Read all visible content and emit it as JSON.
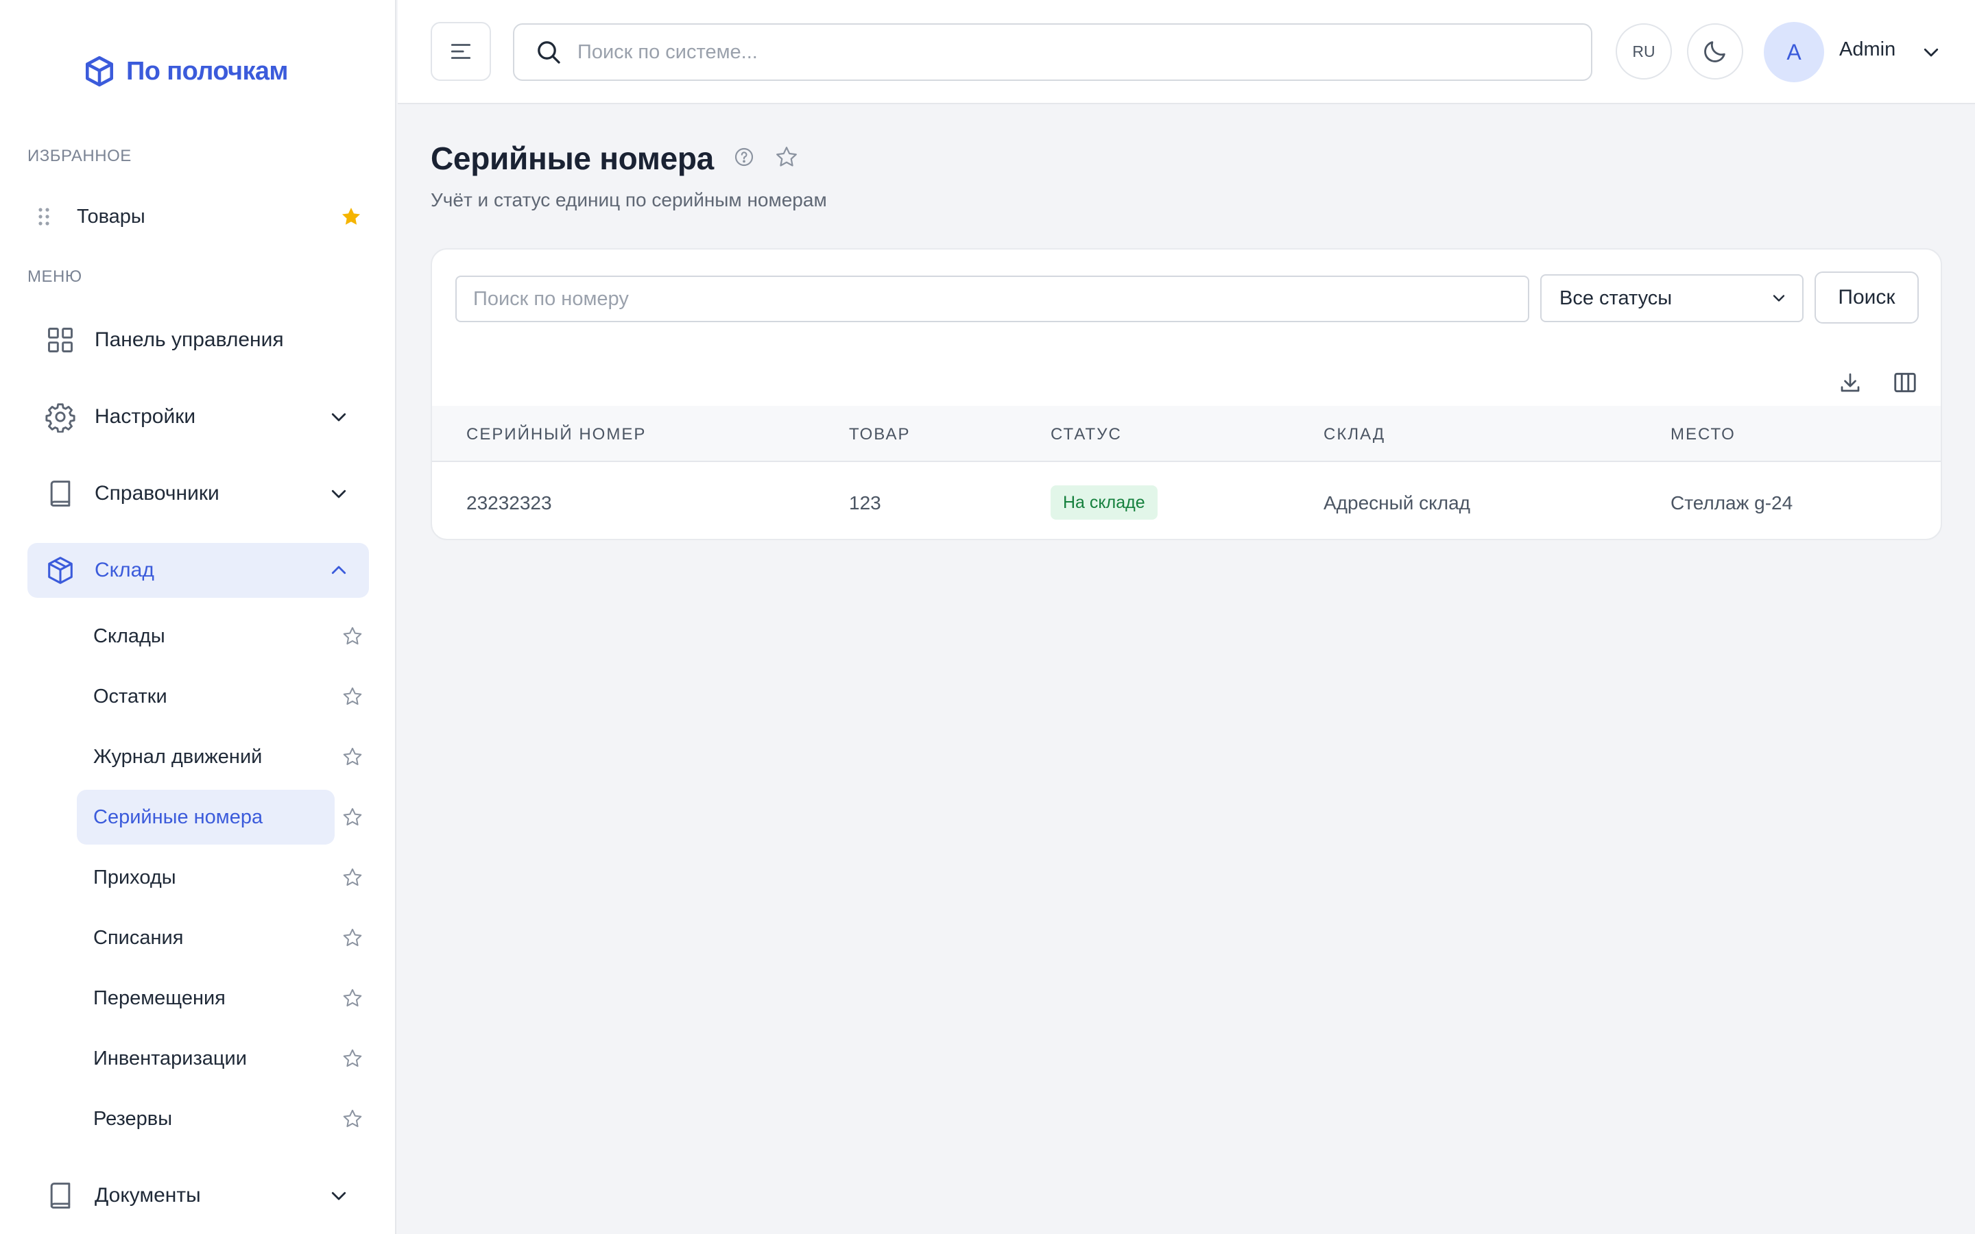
{
  "app": {
    "name": "По полочкам"
  },
  "sidebar": {
    "favorites_label": "ИЗБРАННОЕ",
    "favorites": [
      {
        "label": "Товары"
      }
    ],
    "menu_label": "МЕНЮ",
    "items": [
      {
        "label": "Панель управления",
        "icon": "grid-icon"
      },
      {
        "label": "Настройки",
        "icon": "gear-icon",
        "expanded": false
      },
      {
        "label": "Справочники",
        "icon": "book-icon",
        "expanded": false
      },
      {
        "label": "Склад",
        "icon": "box-icon",
        "expanded": true,
        "active": true
      },
      {
        "label": "Документы",
        "icon": "book-icon",
        "expanded": false
      }
    ],
    "warehouse_subitems": [
      {
        "label": "Склады"
      },
      {
        "label": "Остатки"
      },
      {
        "label": "Журнал движений"
      },
      {
        "label": "Серийные номера",
        "active": true
      },
      {
        "label": "Приходы"
      },
      {
        "label": "Списания"
      },
      {
        "label": "Перемещения"
      },
      {
        "label": "Инвентаризации"
      },
      {
        "label": "Резервы"
      }
    ]
  },
  "topbar": {
    "search_placeholder": "Поиск по системе...",
    "language": "RU",
    "user_initial": "A",
    "user_name": "Admin"
  },
  "page": {
    "title": "Серийные номера",
    "subtitle": "Учёт и статус единиц по серийным номерам"
  },
  "filters": {
    "search_placeholder": "Поиск по номеру",
    "search_value": "",
    "status_selected": "Все статусы",
    "search_button": "Поиск"
  },
  "table": {
    "columns": [
      "СЕРИЙНЫЙ НОМЕР",
      "ТОВАР",
      "СТАТУС",
      "СКЛАД",
      "МЕСТО"
    ],
    "rows": [
      {
        "serial": "23232323",
        "product": "123",
        "status": "На складе",
        "warehouse": "Адресный склад",
        "location": "Стеллаж g-24"
      }
    ]
  },
  "colors": {
    "accent": "#3b5bdb",
    "favorite_star": "#f5b400",
    "status_in_stock_bg": "#e2f6e9",
    "status_in_stock_text": "#15803d"
  }
}
